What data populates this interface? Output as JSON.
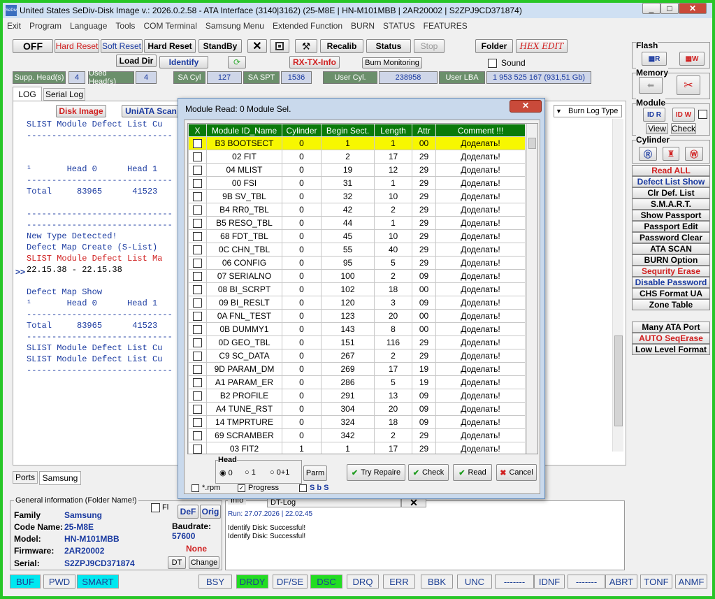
{
  "title": "United States  SeDiv-Disk Image v.: 2026.0.2.58 - ATA Interface (3140|3162)  (25-M8E  | HN-M101MBB | 2AR20002 | S2ZPJ9CD371874)",
  "app_icon": "SeDiv",
  "menu": [
    "Exit",
    "Program",
    "Language",
    "Tools",
    "COM Terminal",
    "Samsung Menu",
    "Extended Function",
    "BURN",
    "STATUS",
    "FEATURES"
  ],
  "toolbar": {
    "off": "OFF",
    "hard_reset_red": "Hard Reset",
    "soft_reset": "Soft Reset",
    "hard_reset": "Hard Reset",
    "standby": "StandBy",
    "recalib": "Recalib",
    "status": "Status",
    "stop": "Stop",
    "folder": "Folder",
    "hexedit": "HEX EDIT",
    "load_dir": "Load Dir",
    "identify": "Identify",
    "rx_tx": "RX-TX-Info",
    "burn_monitoring": "Burn Monitoring",
    "sound": "Sound"
  },
  "infobar": {
    "supp_label": "Supp. Head(s)",
    "supp_val": "4",
    "used_label": "Used Head(s)",
    "used_val": "4",
    "sacyl_label": "SA Cyl",
    "sacyl_val": "127",
    "saspt_label": "SA SPT",
    "saspt_val": "1536",
    "usercyl_label": "User Cyl.",
    "usercyl_val": "238958",
    "userlba_label": "User LBA",
    "userlba_val": "1 953 525 167  (931,51 Gb)"
  },
  "tabs": {
    "log": "LOG",
    "serial": "Serial Log",
    "disk_image": "Disk Image",
    "uniata": "UniATA Scan",
    "burnlog": "Burn Log Type"
  },
  "log_lines": [
    {
      "t": "SLIST Module Defect List Cu",
      "c": "#1a3aa0"
    },
    {
      "t": "-----------------------------",
      "c": "#1a3aa0"
    },
    {
      "t": "",
      "c": "#1a3aa0"
    },
    {
      "t": "",
      "c": "#1a3aa0"
    },
    {
      "t": "¹       Head 0      Head 1",
      "c": "#1a3aa0"
    },
    {
      "t": "-----------------------------",
      "c": "#1a3aa0"
    },
    {
      "t": "Total     83965      41523",
      "c": "#1a3aa0"
    },
    {
      "t": "",
      "c": "#1a3aa0"
    },
    {
      "t": "-----------------------------",
      "c": "#1a3aa0"
    },
    {
      "t": "-----------------------------",
      "c": "#1a3aa0"
    },
    {
      "t": "New Type Detected!",
      "c": "#1a3aa0"
    },
    {
      "t": "Defect Map Create (S-List)",
      "c": "#1a3aa0"
    },
    {
      "t": "SLIST Module Defect List Ma",
      "c": "#d02020"
    },
    {
      "t": "22.15.38 - 22.15.38",
      "c": "#000"
    },
    {
      "t": "",
      "c": "#000"
    },
    {
      "t": "Defect Map Show",
      "c": "#1a3aa0"
    },
    {
      "t": "¹       Head 0      Head 1",
      "c": "#1a3aa0"
    },
    {
      "t": "-----------------------------",
      "c": "#1a3aa0"
    },
    {
      "t": "Total     83965      41523",
      "c": "#1a3aa0"
    },
    {
      "t": "-----------------------------",
      "c": "#1a3aa0"
    },
    {
      "t": "SLIST Module Defect List Cu",
      "c": "#1a3aa0"
    },
    {
      "t": "SLIST Module Defect List Cu",
      "c": "#1a3aa0"
    },
    {
      "t": "-----------------------------",
      "c": "#1a3aa0"
    }
  ],
  "side_arrow": ">>",
  "right": {
    "flash": "Flash",
    "memory": "Memory",
    "module": "Module",
    "view": "View",
    "check": "Check",
    "cylinder": "Cylinder",
    "buttons": [
      {
        "t": "Read ALL",
        "c": "#d02020"
      },
      {
        "t": "Defect List Show",
        "c": "#1a3aa0"
      },
      {
        "t": "Clr Def. List",
        "c": "#000"
      },
      {
        "t": "S.M.A.R.T.",
        "c": "#000"
      },
      {
        "t": "Show Passport",
        "c": "#000"
      },
      {
        "t": "Passport Edit",
        "c": "#000"
      },
      {
        "t": "Password Clear",
        "c": "#000"
      },
      {
        "t": "ATA SCAN",
        "c": "#000"
      },
      {
        "t": "BURN Option",
        "c": "#000"
      },
      {
        "t": "Sequrity Erase",
        "c": "#d02020"
      },
      {
        "t": "Disable Password",
        "c": "#1a3aa0"
      },
      {
        "t": "CHS Format UA",
        "c": "#000"
      },
      {
        "t": "Zone Table",
        "c": "#000"
      }
    ],
    "buttons2": [
      {
        "t": "Many ATA Port",
        "c": "#000"
      },
      {
        "t": "AUTO SeqErase",
        "c": "#d02020"
      },
      {
        "t": "Low Level Format",
        "c": "#000"
      }
    ]
  },
  "bottom_tabs": {
    "ports": "Ports",
    "samsung": "Samsung"
  },
  "general": {
    "legend": "General information (Folder Name!)",
    "fl": "Fl",
    "def": "DeF",
    "orig": "Orig",
    "family_l": "Family",
    "family_v": "Samsung",
    "code_l": "Code Name:",
    "code_v": "25-M8E",
    "model_l": "Model:",
    "model_v": "HN-M101MBB",
    "fw_l": "Firmware:",
    "fw_v": "2AR20002",
    "serial_l": "Serial:",
    "serial_v": "S2ZPJ9CD371874",
    "baud_l": "Baudrate:",
    "baud_v": "57600",
    "none": "None",
    "dt": "DT",
    "change": "Change"
  },
  "info": {
    "tab1": "Info",
    "tab2": "DT-Log",
    "run": "Run: 27.07.2026  |  22.02.45",
    "l1": "Identify Disk: Successful!",
    "l2": "Identify Disk: Successful!"
  },
  "status": [
    "BUF",
    "PWD",
    "SMART",
    "BSY",
    "DRDY",
    "DF/SE",
    "DSC",
    "DRQ",
    "ERR",
    "BBK",
    "UNC",
    "-------",
    "IDNF",
    "-------",
    "ABRT",
    "TONF",
    "ANMF"
  ],
  "dialog": {
    "title": "Module Read: 0 Module Sel.",
    "close": "✕",
    "headers": [
      "X",
      "Module ID_Name",
      "Cylinder",
      "Begin Sect.",
      "Length",
      "Attr",
      "Comment !!!"
    ],
    "rows": [
      [
        "B3 BOOTSECT",
        "0",
        "1",
        "1",
        "00",
        "Доделать!"
      ],
      [
        "02 FIT",
        "0",
        "2",
        "17",
        "29",
        "Доделать!"
      ],
      [
        "04 MLIST",
        "0",
        "19",
        "12",
        "29",
        "Доделать!"
      ],
      [
        "00 FSI",
        "0",
        "31",
        "1",
        "29",
        "Доделать!"
      ],
      [
        "9B SV_TBL",
        "0",
        "32",
        "10",
        "29",
        "Доделать!"
      ],
      [
        "B4 RR0_TBL",
        "0",
        "42",
        "2",
        "29",
        "Доделать!"
      ],
      [
        "B5 RESO_TBL",
        "0",
        "44",
        "1",
        "29",
        "Доделать!"
      ],
      [
        "68 FDT_TBL",
        "0",
        "45",
        "10",
        "29",
        "Доделать!"
      ],
      [
        "0C CHN_TBL",
        "0",
        "55",
        "40",
        "29",
        "Доделать!"
      ],
      [
        "06 CONFIG",
        "0",
        "95",
        "5",
        "29",
        "Доделать!"
      ],
      [
        "07 SERIALNO",
        "0",
        "100",
        "2",
        "09",
        "Доделать!"
      ],
      [
        "08 BI_SCRPT",
        "0",
        "102",
        "18",
        "00",
        "Доделать!"
      ],
      [
        "09 BI_RESLT",
        "0",
        "120",
        "3",
        "09",
        "Доделать!"
      ],
      [
        "0A FNL_TEST",
        "0",
        "123",
        "20",
        "00",
        "Доделать!"
      ],
      [
        "0B DUMMY1",
        "0",
        "143",
        "8",
        "00",
        "Доделать!"
      ],
      [
        "0D GEO_TBL",
        "0",
        "151",
        "116",
        "29",
        "Доделать!"
      ],
      [
        "C9 SC_DATA",
        "0",
        "267",
        "2",
        "29",
        "Доделать!"
      ],
      [
        "9D PARAM_DM",
        "0",
        "269",
        "17",
        "19",
        "Доделать!"
      ],
      [
        "A1 PARAM_ER",
        "0",
        "286",
        "5",
        "19",
        "Доделать!"
      ],
      [
        "B2 PROFILE",
        "0",
        "291",
        "13",
        "09",
        "Доделать!"
      ],
      [
        "A4 TUNE_RST",
        "0",
        "304",
        "20",
        "09",
        "Доделать!"
      ],
      [
        "14 TMPRTURE",
        "0",
        "324",
        "18",
        "09",
        "Доделать!"
      ],
      [
        "69 SCRAMBER",
        "0",
        "342",
        "2",
        "29",
        "Доделать!"
      ],
      [
        "03 FIT2",
        "1",
        "1",
        "17",
        "29",
        "Доделать!"
      ]
    ],
    "head": "Head",
    "h0": "0",
    "h1": "1",
    "h01": "0+1",
    "parm": "Parm",
    "try": "Try Repaire",
    "check": "Check",
    "read": "Read",
    "cancel": "Cancel",
    "rpm": "*.rpm",
    "progress": "Progress",
    "sbs": "S b S"
  },
  "colors": {
    "frame": "#27c627",
    "highlight": "#f7f700",
    "header_green": "#0a7a0a"
  }
}
